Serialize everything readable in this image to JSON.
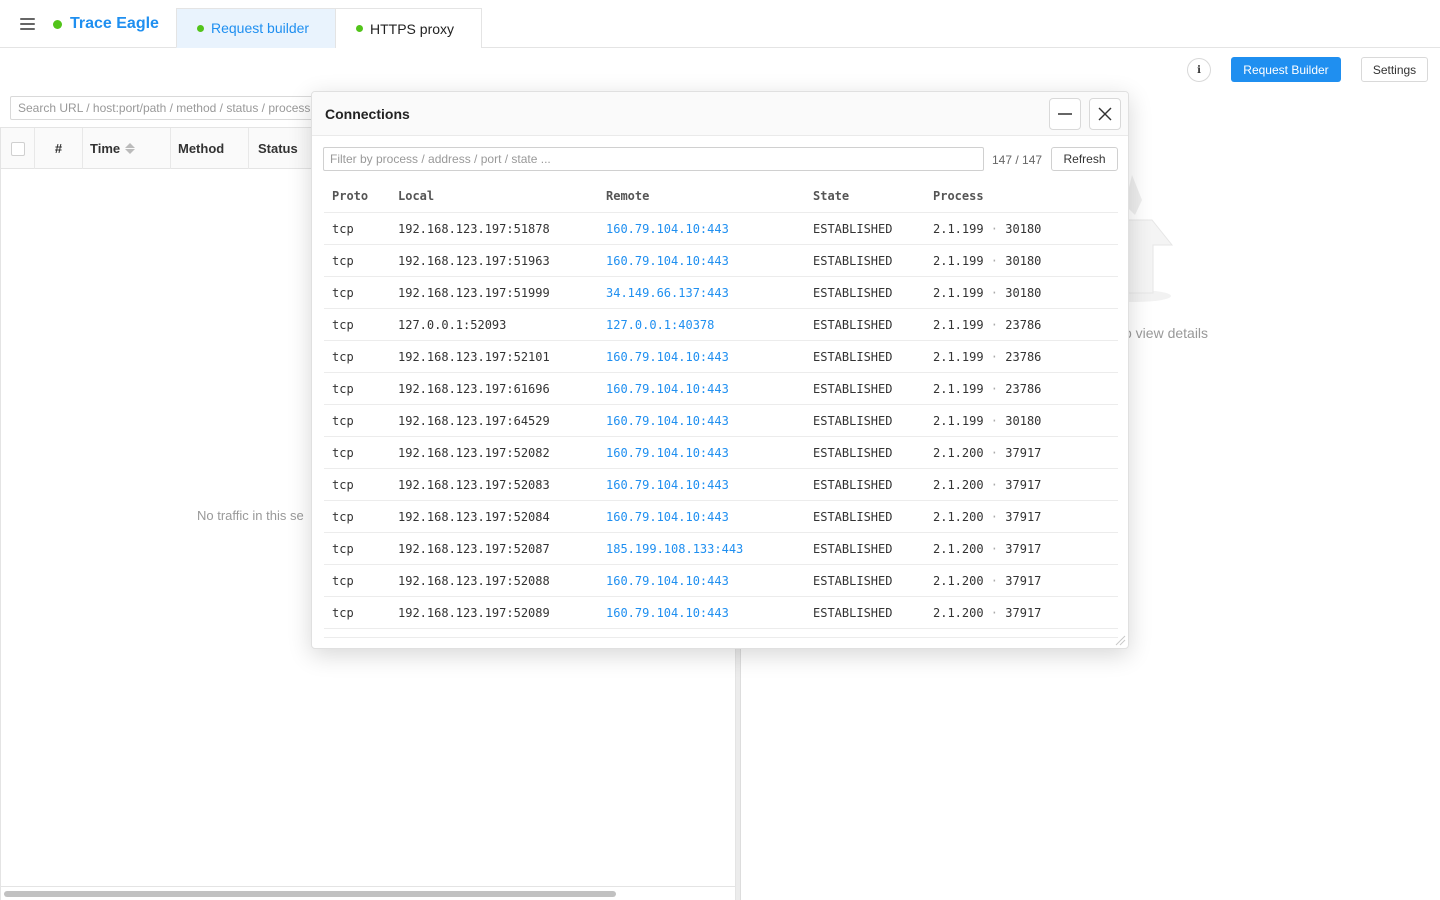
{
  "app": {
    "title": "Trace Eagle",
    "status_color": "#52c41a",
    "accent_color": "#1f8ff0"
  },
  "tabs": [
    {
      "label": "Request builder",
      "active": true
    },
    {
      "label": "HTTPS proxy",
      "active": false
    }
  ],
  "toolbar": {
    "info_label": "i",
    "request_builder_label": "Request Builder",
    "settings_label": "Settings"
  },
  "traffic": {
    "search_placeholder": "Search URL / host:port/path / method / status / process",
    "columns": {
      "num": "#",
      "time": "Time",
      "method": "Method",
      "status": "Status"
    },
    "empty_text": "No traffic in this se"
  },
  "detail": {
    "hint": "o view details"
  },
  "connections": {
    "title": "Connections",
    "filter_placeholder": "Filter by process / address / port / state ...",
    "count": "147 / 147",
    "refresh_label": "Refresh",
    "columns": {
      "proto": "Proto",
      "local": "Local",
      "remote": "Remote",
      "state": "State",
      "process": "Process"
    },
    "rows": [
      {
        "proto": "tcp",
        "local": "192.168.123.197:51878",
        "remote": "160.79.104.10:443",
        "state": "ESTABLISHED",
        "process": "2.1.199",
        "pid": "30180"
      },
      {
        "proto": "tcp",
        "local": "192.168.123.197:51963",
        "remote": "160.79.104.10:443",
        "state": "ESTABLISHED",
        "process": "2.1.199",
        "pid": "30180"
      },
      {
        "proto": "tcp",
        "local": "192.168.123.197:51999",
        "remote": "34.149.66.137:443",
        "state": "ESTABLISHED",
        "process": "2.1.199",
        "pid": "30180"
      },
      {
        "proto": "tcp",
        "local": "127.0.0.1:52093",
        "remote": "127.0.0.1:40378",
        "state": "ESTABLISHED",
        "process": "2.1.199",
        "pid": "23786"
      },
      {
        "proto": "tcp",
        "local": "192.168.123.197:52101",
        "remote": "160.79.104.10:443",
        "state": "ESTABLISHED",
        "process": "2.1.199",
        "pid": "23786"
      },
      {
        "proto": "tcp",
        "local": "192.168.123.197:61696",
        "remote": "160.79.104.10:443",
        "state": "ESTABLISHED",
        "process": "2.1.199",
        "pid": "23786"
      },
      {
        "proto": "tcp",
        "local": "192.168.123.197:64529",
        "remote": "160.79.104.10:443",
        "state": "ESTABLISHED",
        "process": "2.1.199",
        "pid": "30180"
      },
      {
        "proto": "tcp",
        "local": "192.168.123.197:52082",
        "remote": "160.79.104.10:443",
        "state": "ESTABLISHED",
        "process": "2.1.200",
        "pid": "37917"
      },
      {
        "proto": "tcp",
        "local": "192.168.123.197:52083",
        "remote": "160.79.104.10:443",
        "state": "ESTABLISHED",
        "process": "2.1.200",
        "pid": "37917"
      },
      {
        "proto": "tcp",
        "local": "192.168.123.197:52084",
        "remote": "160.79.104.10:443",
        "state": "ESTABLISHED",
        "process": "2.1.200",
        "pid": "37917"
      },
      {
        "proto": "tcp",
        "local": "192.168.123.197:52087",
        "remote": "185.199.108.133:443",
        "state": "ESTABLISHED",
        "process": "2.1.200",
        "pid": "37917"
      },
      {
        "proto": "tcp",
        "local": "192.168.123.197:52088",
        "remote": "160.79.104.10:443",
        "state": "ESTABLISHED",
        "process": "2.1.200",
        "pid": "37917"
      },
      {
        "proto": "tcp",
        "local": "192.168.123.197:52089",
        "remote": "160.79.104.10:443",
        "state": "ESTABLISHED",
        "process": "2.1.200",
        "pid": "37917"
      }
    ]
  }
}
